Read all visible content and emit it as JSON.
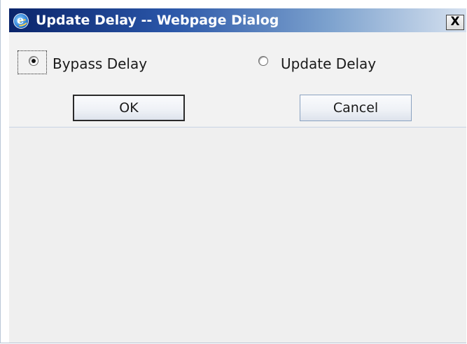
{
  "dialog": {
    "title": "Update Delay -- Webpage Dialog",
    "icon": "internet-explorer-icon",
    "close_label": "X"
  },
  "options": {
    "bypass_label": "Bypass Delay",
    "bypass_selected": true,
    "update_label": "Update Delay",
    "update_selected": false
  },
  "buttons": {
    "ok_label": "OK",
    "cancel_label": "Cancel"
  }
}
